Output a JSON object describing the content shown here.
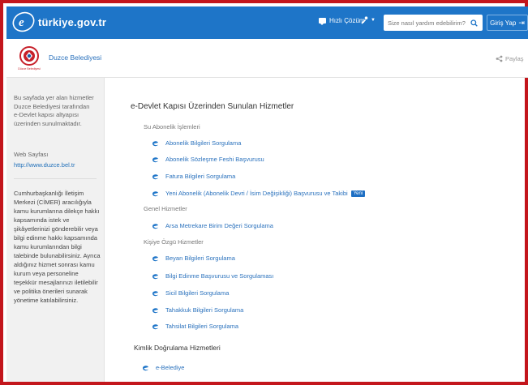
{
  "topbar": {
    "logo_text": "türkiye.gov.tr",
    "quick_solution": "Hızlı Çözüm",
    "search_placeholder": "Size nasıl yardım edebilirim?",
    "login_label": "Giriş Yap",
    "colors": {
      "bar": "#1e75c8",
      "frame": "#c3161c"
    }
  },
  "institution": {
    "name": "Duzce Belediyesi",
    "logo_caption": "Düzce Belediyesi",
    "share_label": "Paylaş"
  },
  "sidebar": {
    "intro": "Bu sayfada yer alan hizmetler Duzce Belediyesi tarafından e-Devlet kapısı altyapısı üzerinden sunulmaktadır.",
    "web_label": "Web Sayfası",
    "web_link": "http://www.duzce.bel.tr",
    "cimer_text": "Cumhurbaşkanlığı İletişim Merkezi (CİMER) aracılığıyla kamu kurumlarına dilekçe hakkı kapsamında istek ve şikâyetlerinizi gönderebilir veya bilgi edinme hakkı kapsamında kamu kurumlarından bilgi talebinde bulunabilirsiniz. Ayrıca aldığınız hizmet sonrası kamu kurum veya personeline teşekkür mesajlarınızı iletilebilir ve politika önerileri sunarak yönetime katılabilirsiniz."
  },
  "main": {
    "title": "e-Devlet Kapısı Üzerinden Sunulan Hizmetler",
    "groups": [
      {
        "label": "Su Abonelik İşlemleri",
        "items": [
          "Abonelik Bilgileri Sorgulama",
          "Abonelik Sözleşme Feshi Başvurusu",
          "Fatura Bilgileri Sorgulama",
          "Yeni Abonelik (Abonelik Devri / İsim Değişikliği) Başvurusu ve Takibi"
        ],
        "new_badge": "Yeni"
      },
      {
        "label": "Genel Hizmetler",
        "items": [
          "Arsa Metrekare Birim Değeri Sorgulama"
        ]
      },
      {
        "label": "Kişiye Özgü Hizmetler",
        "items": [
          "Beyan Bilgileri Sorgulama",
          "Bilgi Edinme Başvurusu ve Sorgulaması",
          "Sicil Bilgileri Sorgulama",
          "Tahakkuk Bilgileri Sorgulama",
          "Tahsilat Bilgileri Sorgulama"
        ]
      }
    ],
    "kimlik_title": "Kimlik Doğrulama Hizmetleri",
    "kimlik_item": "e-Belediye"
  }
}
